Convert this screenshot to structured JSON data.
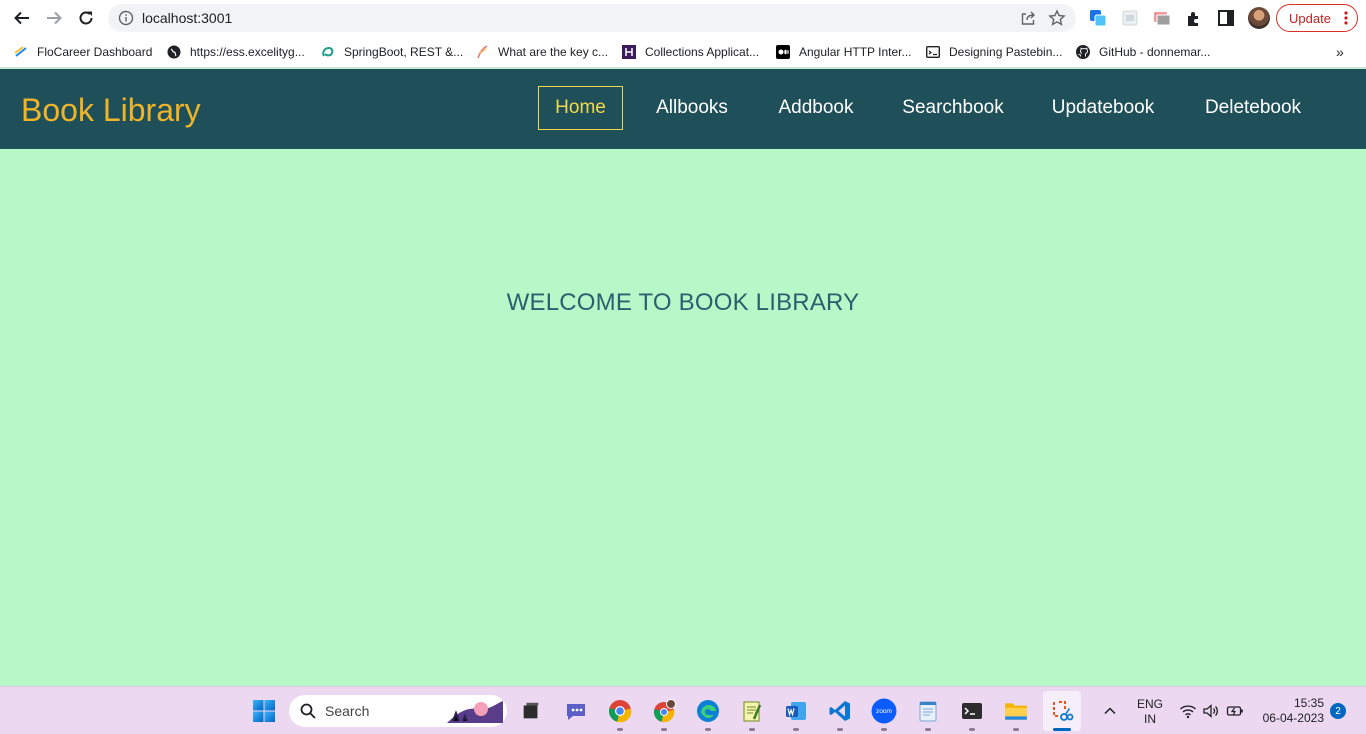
{
  "browser": {
    "url": "localhost:3001",
    "update_label": "Update",
    "bookmarks": [
      {
        "label": "FloCareer Dashboard",
        "icon": "flocareer-icon"
      },
      {
        "label": "https://ess.excelityg...",
        "icon": "globe-icon"
      },
      {
        "label": "SpringBoot, REST &...",
        "icon": "springboot-icon"
      },
      {
        "label": "What are the key c...",
        "icon": "feather-icon"
      },
      {
        "label": "Collections Applicat...",
        "icon": "h-logo-icon"
      },
      {
        "label": "Angular HTTP Inter...",
        "icon": "medium-icon"
      },
      {
        "label": "Designing Pastebin...",
        "icon": "terminal-box-icon"
      },
      {
        "label": "GitHub - donnemar...",
        "icon": "github-icon"
      }
    ],
    "more_bookmarks": "»"
  },
  "app": {
    "brand": "Book Library",
    "nav": [
      {
        "label": "Home",
        "active": true
      },
      {
        "label": "Allbooks",
        "active": false
      },
      {
        "label": "Addbook",
        "active": false
      },
      {
        "label": "Searchbook",
        "active": false
      },
      {
        "label": "Updatebook",
        "active": false
      },
      {
        "label": "Deletebook",
        "active": false
      }
    ],
    "welcome": "WELCOME TO BOOK LIBRARY"
  },
  "taskbar": {
    "search_placeholder": "Search",
    "apps": [
      "file-explorer-dark-icon",
      "teams-chat-icon",
      "chrome-icon",
      "chrome-profile-icon",
      "edge-icon",
      "notepad-icon",
      "word-icon",
      "vscode-icon",
      "zoom-icon",
      "notepad-app-icon",
      "terminal-icon",
      "folder-icon",
      "snipping-tool-icon"
    ],
    "lang_line1": "ENG",
    "lang_line2": "IN",
    "time": "15:35",
    "date": "06-04-2023",
    "notifications": "2"
  },
  "colors": {
    "page_bg": "#b7f8c8",
    "nav_bg": "#1f5059",
    "brand": "#f0b429",
    "active_link": "#f2d94a",
    "welcome_text": "#2b5f6f"
  }
}
